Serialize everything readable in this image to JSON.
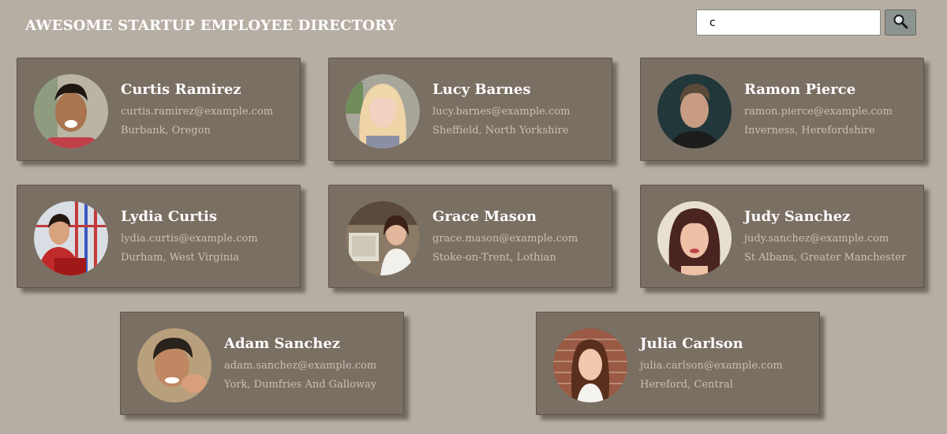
{
  "header": {
    "title": "AWESOME STARTUP EMPLOYEE DIRECTORY"
  },
  "search": {
    "value": "c",
    "button_icon": "search-icon"
  },
  "employees": [
    {
      "name": "Curtis Ramirez",
      "email": "curtis.ramirez@example.com",
      "location": "Burbank, Oregon"
    },
    {
      "name": "Lucy Barnes",
      "email": "lucy.barnes@example.com",
      "location": "Sheffield, North Yorkshire"
    },
    {
      "name": "Ramon Pierce",
      "email": "ramon.pierce@example.com",
      "location": "Inverness, Herefordshire"
    },
    {
      "name": "Lydia Curtis",
      "email": "lydia.curtis@example.com",
      "location": "Durham, West Virginia"
    },
    {
      "name": "Grace Mason",
      "email": "grace.mason@example.com",
      "location": "Stoke-on-Trent, Lothian"
    },
    {
      "name": "Judy Sanchez",
      "email": "judy.sanchez@example.com",
      "location": "St Albans, Greater Manchester"
    },
    {
      "name": "Adam Sanchez",
      "email": "adam.sanchez@example.com",
      "location": "York, Dumfries And Galloway"
    },
    {
      "name": "Julia Carlson",
      "email": "julia.carlson@example.com",
      "location": "Hereford, Central"
    }
  ]
}
